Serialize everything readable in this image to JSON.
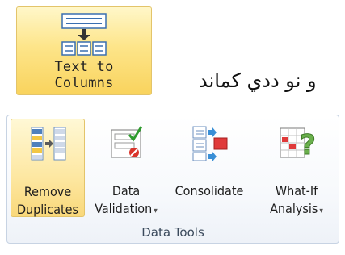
{
  "text_to_columns": {
    "line1": "Text to",
    "line2": "Columns"
  },
  "caption": "و نو ددي كماند",
  "ribbon": {
    "remove_duplicates": {
      "line1": "Remove",
      "line2": "Duplicates"
    },
    "data_validation": {
      "line1": "Data",
      "line2": "Validation",
      "dropdown": "▾"
    },
    "consolidate": {
      "line1": "Consolidate"
    },
    "what_if": {
      "line1": "What-If",
      "line2": "Analysis",
      "dropdown": "▾"
    },
    "group_label": "Data Tools"
  }
}
